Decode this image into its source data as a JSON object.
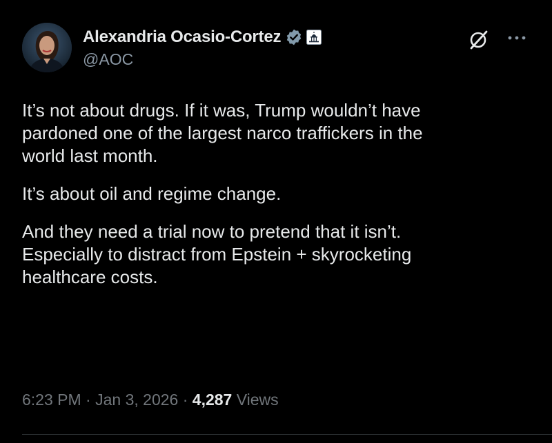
{
  "author": {
    "display_name": "Alexandria Ocasio-Cortez",
    "handle": "@AOC"
  },
  "icons": {
    "verified": "verified-badge-icon",
    "affiliation": "capitol-affiliation-icon",
    "grok": "grok-icon",
    "more": "more-options-icon"
  },
  "colors": {
    "background": "#000000",
    "text": "#e7e9ea",
    "muted": "#71767b",
    "verified_badge": "#829aab"
  },
  "post": {
    "paragraphs": [
      "It’s not about drugs. If it was, Trump wouldn’t have\npardoned one of the largest narco traffickers in the\nworld last month.",
      "It’s about oil and regime change.",
      "And they need a trial now to pretend that it isn’t.\nEspecially to distract from Epstein + skyrocketing\nhealthcare costs."
    ]
  },
  "meta": {
    "time": "6:23 PM",
    "separator": "·",
    "date": "Jan 3, 2026",
    "views_count": "4,287",
    "views_label": "Views"
  }
}
